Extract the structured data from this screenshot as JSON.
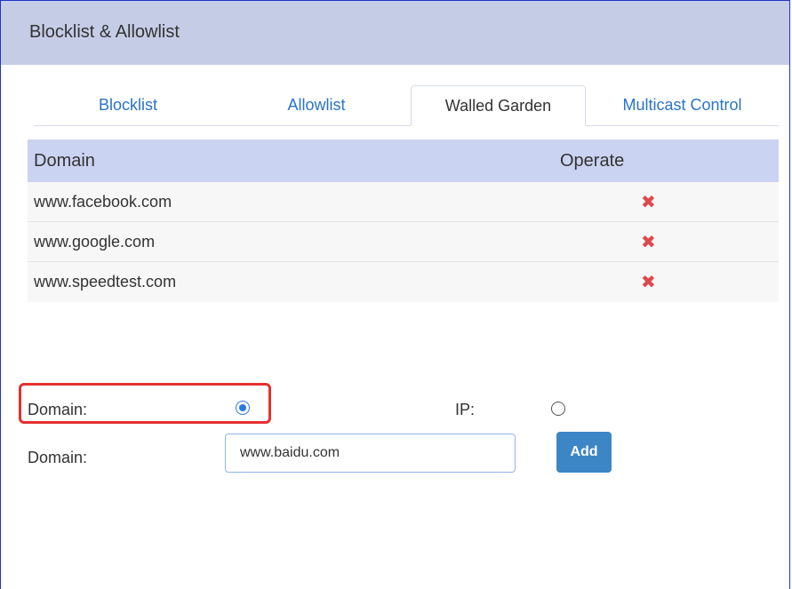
{
  "header": {
    "title": "Blocklist & Allowlist"
  },
  "tabs": [
    {
      "label": "Blocklist"
    },
    {
      "label": "Allowlist"
    },
    {
      "label": "Walled Garden"
    },
    {
      "label": "Multicast Control"
    }
  ],
  "active_tab": "Walled Garden",
  "table": {
    "columns": [
      "Domain",
      "Operate"
    ],
    "rows": [
      {
        "domain": "www.facebook.com",
        "operate": "✖"
      },
      {
        "domain": "www.google.com",
        "operate": "✖"
      },
      {
        "domain": "www.speedtest.com",
        "operate": "✖"
      }
    ]
  },
  "form": {
    "type_label_domain": "Domain:",
    "type_label_ip": "IP:",
    "selected_type": "Domain",
    "domain_label": "Domain:",
    "domain_value": "www.baidu.com",
    "add_label": "Add"
  },
  "colors": {
    "header_bg": "#c5cde6",
    "table_header_bg": "#cbd3f2",
    "link": "#2a74c4",
    "delete": "#e0484a",
    "highlight": "#e53030",
    "button": "#3d86c6"
  }
}
